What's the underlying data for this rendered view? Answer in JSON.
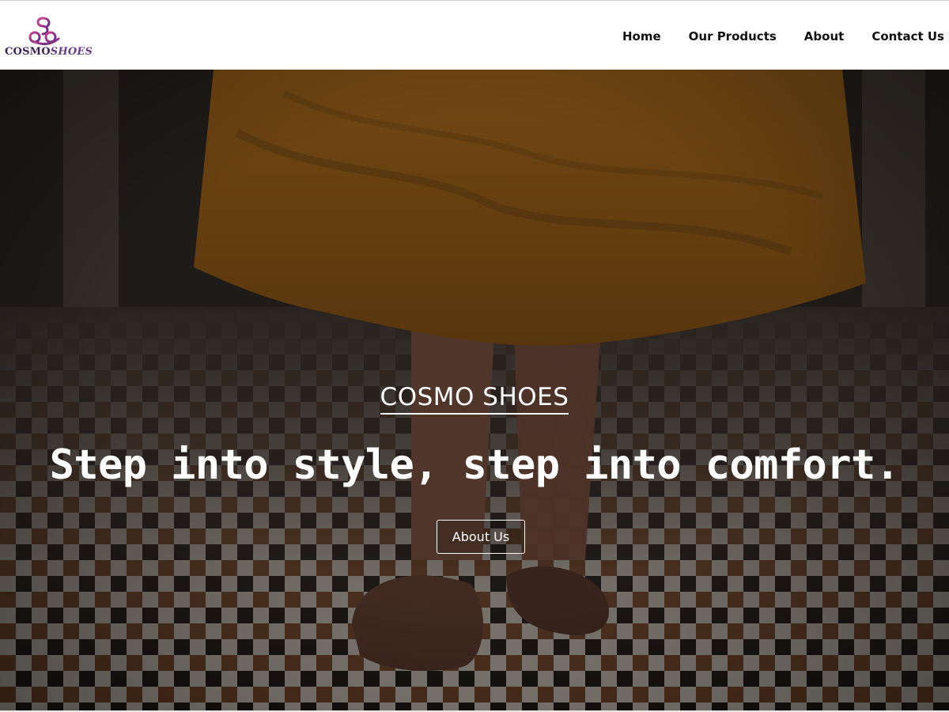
{
  "brand": {
    "logo_text_bold": "COSMO",
    "logo_text_styled": "SHOES",
    "accent_color": "#6b3e86",
    "logo_gradient": [
      "#c23b8a",
      "#5b2a86"
    ]
  },
  "nav": {
    "items": [
      {
        "label": "Home"
      },
      {
        "label": "Our Products"
      },
      {
        "label": "About"
      },
      {
        "label": "Contact Us"
      }
    ]
  },
  "hero": {
    "eyebrow": "COSMO SHOES",
    "title": "Step into style, step into comfort.",
    "cta_label": "About Us"
  }
}
